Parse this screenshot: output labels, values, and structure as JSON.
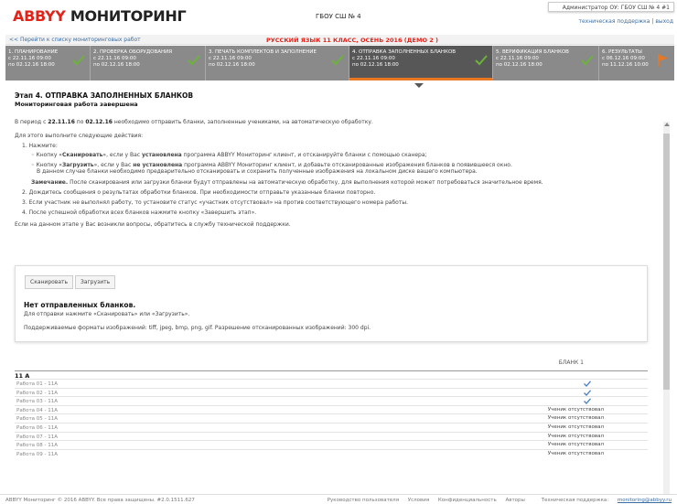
{
  "header": {
    "logo_brand": "ABBYY",
    "logo_product": "МОНИТОРИНГ",
    "school": "ГБОУ СШ № 4",
    "admin_user": "Администратор ОУ: ГБОУ СШ № 4 #1",
    "support_link": "техническая поддержка",
    "link_sep": "|",
    "logout_link": "выход"
  },
  "crumb": {
    "back_link": "<< Перейти к списку мониторинговых работ",
    "course_title": "РУССКИЙ ЯЗЫК 11 КЛАСС, ОСЕНЬ 2016 (ДЕМО 2 )"
  },
  "steps": [
    {
      "title": "1. ПЛАНИРОВАНИЕ",
      "from": "с   22.11.16 09:00",
      "to": "по 02.12.16 18:00",
      "done": true
    },
    {
      "title": "2. ПРОВЕРКА ОБОРУДОВАНИЯ",
      "from": "с   22.11.16 09:00",
      "to": "по 02.12.16 18:00",
      "done": true
    },
    {
      "title": "3. ПЕЧАТЬ КОМПЛЕКТОВ И ЗАПОЛНЕНИЕ",
      "from": "с   22.11.16 09:00",
      "to": "по 02.12.16 18:00",
      "done": true
    },
    {
      "title": "4. ОТПРАВКА ЗАПОЛНЕННЫХ БЛАНКОВ",
      "from": "с   22.11.16 09:00",
      "to": "по 02.12.16 18:00",
      "done": true
    },
    {
      "title": "5. ВЕРИФИКАЦИЯ БЛАНКОВ",
      "from": "с   22.11.16 09:00",
      "to": "по 02.12.16 18:00",
      "done": true
    },
    {
      "title": "6. РЕЗУЛЬТАТЫ",
      "from": "с   06.12.16 09:00",
      "to": "по 11.12.16 10:00",
      "done": false
    }
  ],
  "stage": {
    "title": "Этап 4. ОТПРАВКА ЗАПОЛНЕННЫХ БЛАНКОВ",
    "subtitle": "Мониторинговая работа завершена",
    "period_pre": "В период с ",
    "period_from": "22.11.16",
    "period_mid": " по ",
    "period_to": "02.12.16",
    "period_post": " необходимо отправить бланки, заполненные учениками, на автоматическую обработку.",
    "instr_intro": "Для этого выполните следующие действия:",
    "step1": "1. Нажмите:",
    "step1a_pre": "Кнопку «",
    "step1a_btn": "Сканировать",
    "step1a_mid": "», если у Вас ",
    "step1a_bold": "установлена",
    "step1a_post": " программа ABBYY Мониторинг клиент, и отсканируйте бланки с помощью сканера;",
    "step1b_pre": "Кнопку «",
    "step1b_btn": "Загрузить",
    "step1b_mid": "», если у Вас ",
    "step1b_bold": "не установлена",
    "step1b_post": " программа ABBYY Мониторинг клиент, и добавьте отсканированные изображения бланков в появившееся окно.",
    "step1b_line2": "В данном случае бланки необходимо предварительно отсканировать и сохранить полученные изображения на локальном диске вашего компьютера.",
    "note_label": "Замечание.",
    "note_text": " После сканирования или загрузки бланки будут отправлены на автоматическую обработку, для выполнения которой может потребоваться значительное время.",
    "step2": "2. Дождитесь сообщения о результатах обработки бланков. При необходимости отправьте указанные бланки повторно.",
    "step3": "3. Если участник не выполнял работу, то установите статус «участник отсутствовал» на против соответствующего номера работы.",
    "step4": "4. После успешной обработки всех бланков нажмите кнопку «Завершить этап».",
    "support_note": "Если на данном этапе у Вас возникли вопросы, обратитесь в службу технической поддержки."
  },
  "upload": {
    "scan_btn": "Сканировать",
    "load_btn": "Загрузить",
    "empty_title": "Нет отправленных бланков.",
    "empty_hint": "Для отправки нажмите «Сканировать» или «Загрузить».",
    "formats": "Поддерживаемые форматы изображений: tiff, jpeg, bmp, png, gif. Разрешение отсканированных изображений: 300 dpi."
  },
  "table": {
    "column": "БЛАНК 1",
    "group": "11 А",
    "rows": [
      {
        "name": "Работа 01 - 11А",
        "status": "check"
      },
      {
        "name": "Работа 02 - 11А",
        "status": "check"
      },
      {
        "name": "Работа 03 - 11А",
        "status": "check"
      },
      {
        "name": "Работа 04 - 11А",
        "status": "Ученик отсутствовал"
      },
      {
        "name": "Работа 05 - 11А",
        "status": "Ученик отсутствовал"
      },
      {
        "name": "Работа 06 - 11А",
        "status": "Ученик отсутствовал"
      },
      {
        "name": "Работа 07 - 11А",
        "status": "Ученик отсутствовал"
      },
      {
        "name": "Работа 08 - 11А",
        "status": "Ученик отсутствовал"
      },
      {
        "name": "Работа 09 - 11А",
        "status": "Ученик отсутствовал"
      }
    ]
  },
  "footer": {
    "copyright": "ABBYY Мониторинг © 2016 ABBYY. Все права защищены.   #2.0.1511.627",
    "guide": "Руководство пользователя",
    "terms": "Условия",
    "privacy": "Конфиденциальность",
    "authors": "Авторы",
    "support_label": "Техническая поддержка: ",
    "support_mail": "monitoring@abbyy.ru"
  },
  "colors": {
    "accent_red": "#e2231a",
    "step_bg": "#8a8a8a",
    "step_active": "#575757",
    "check_green": "#6bb33a",
    "check_blue": "#4a7fc1",
    "flag_orange": "#e87722"
  }
}
